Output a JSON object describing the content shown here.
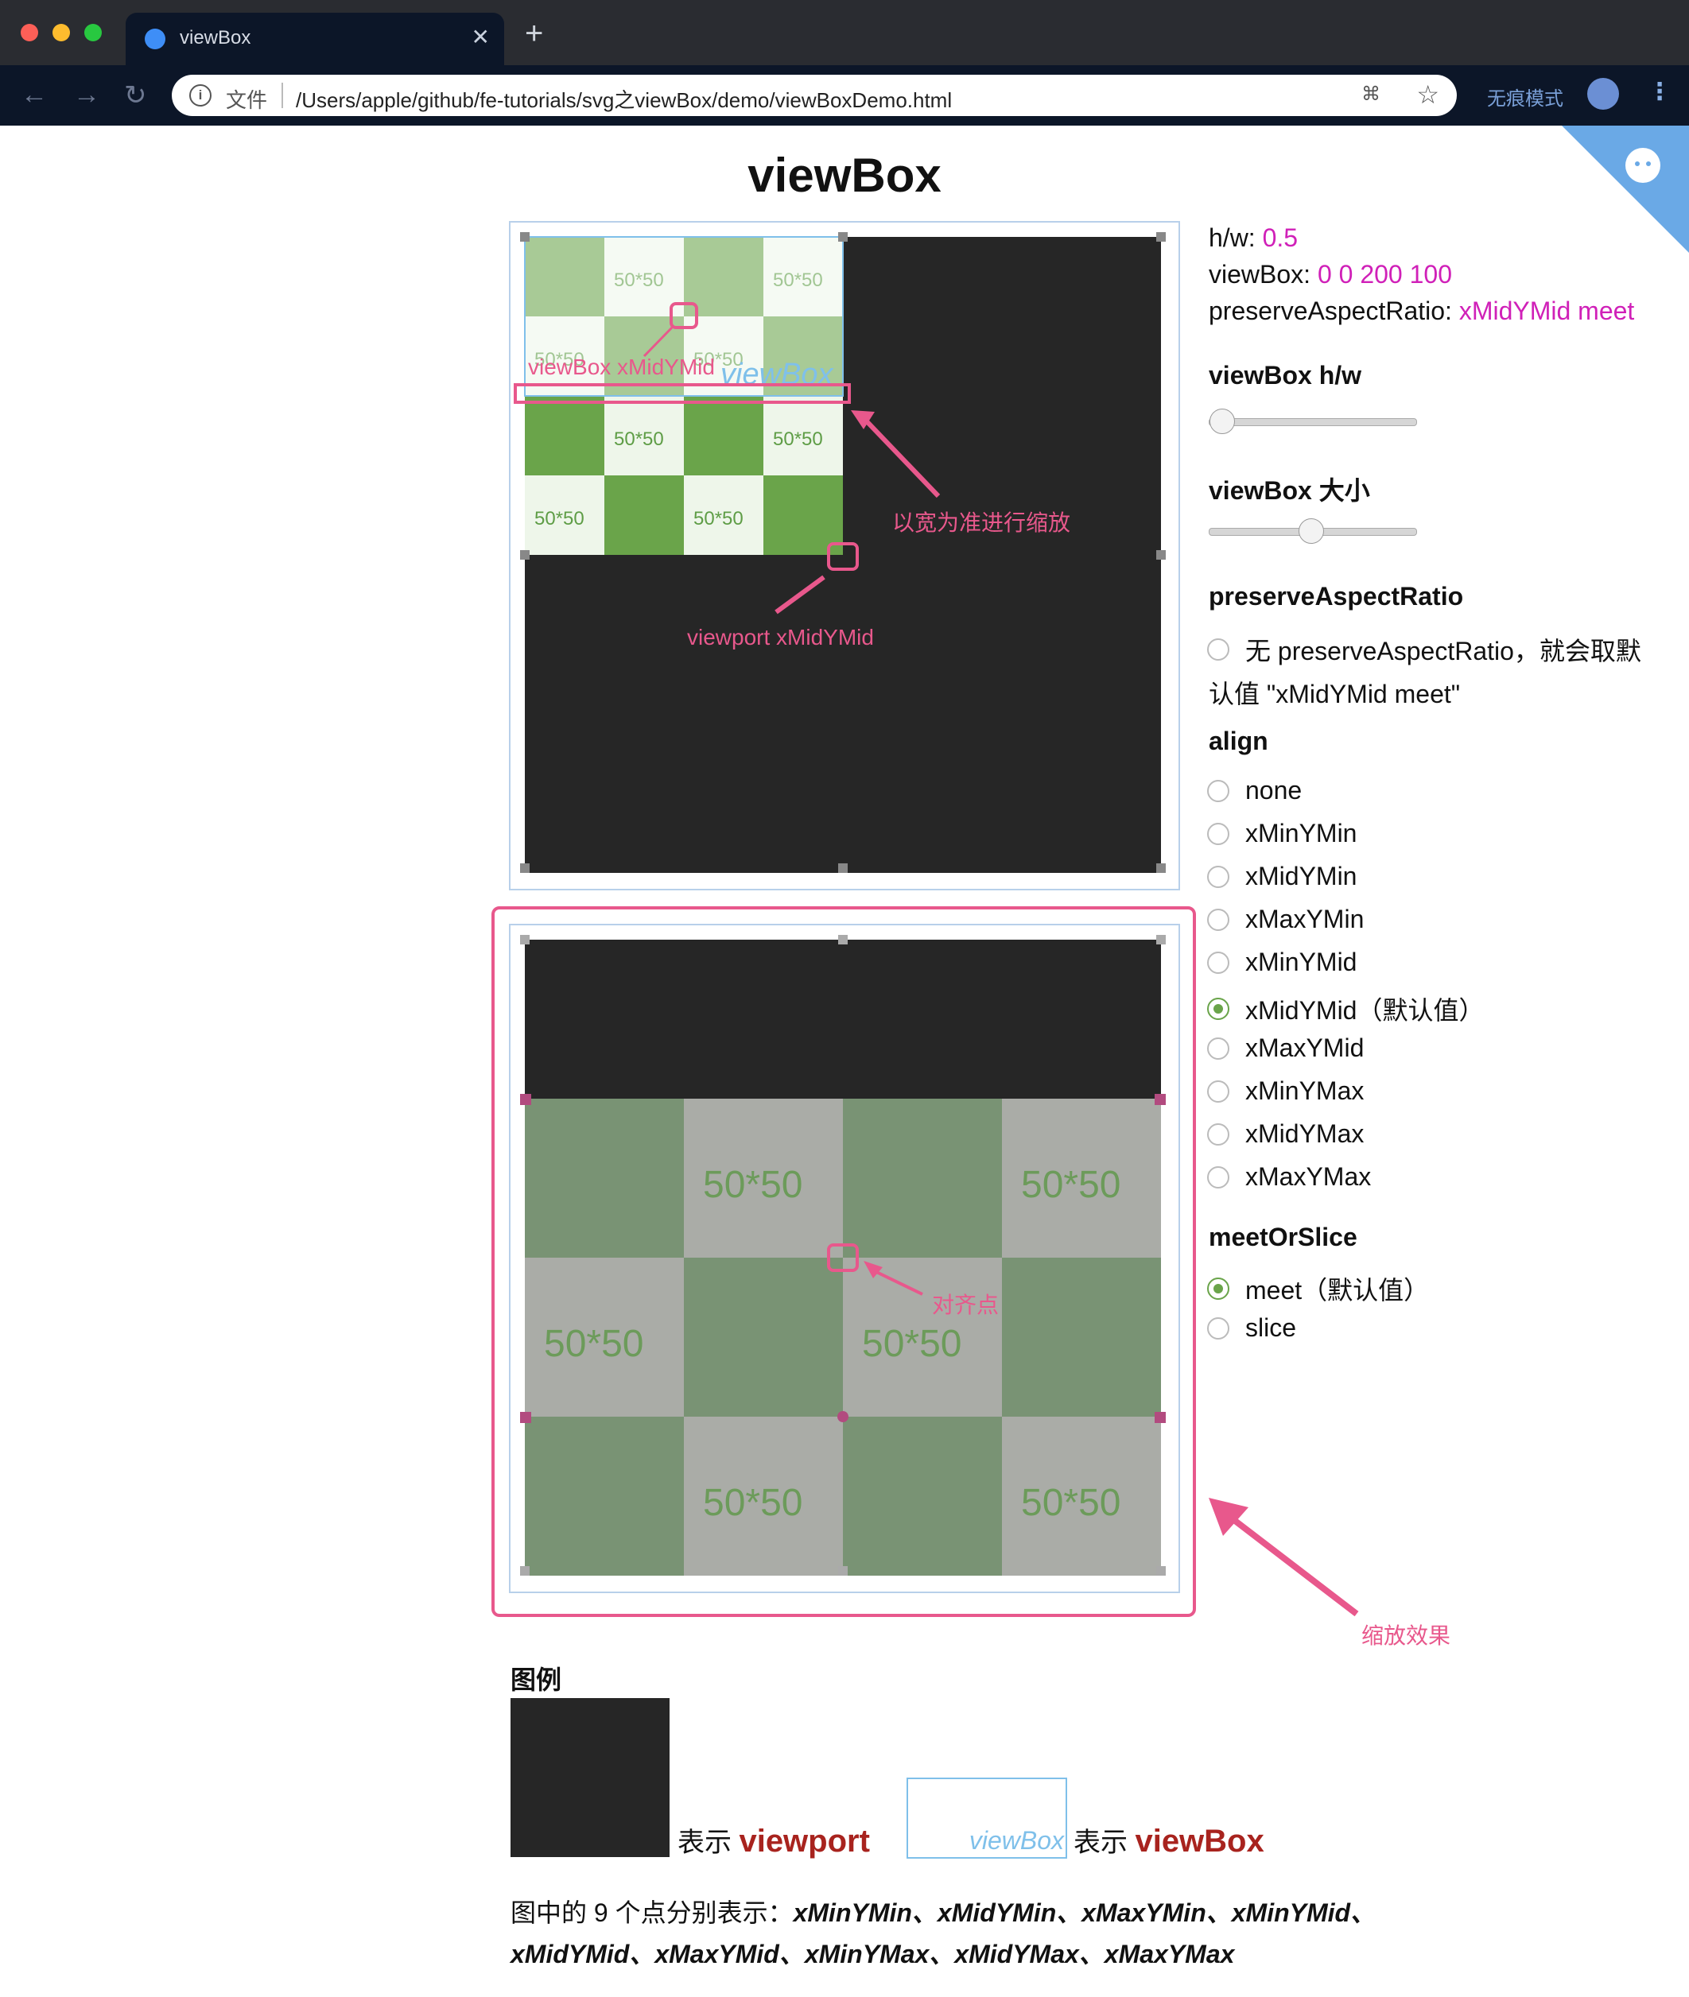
{
  "browser": {
    "tab_title": "viewBox",
    "address_file_label": "文件",
    "url": "/Users/apple/github/fe-tutorials/svg之viewBox/demo/viewBoxDemo.html",
    "incognito_label": "无痕模式"
  },
  "page": {
    "title": "viewBox",
    "info": {
      "hw_label": "h/w:",
      "hw_value": "0.5",
      "viewbox_label": "viewBox:",
      "viewbox_value": "0 0 200 100",
      "par_label": "preserveAspectRatio:",
      "par_value": "xMidYMid meet"
    },
    "controls": {
      "slider_hw_label": "viewBox h/w",
      "slider_hw_value": 0.0,
      "slider_size_label": "viewBox 大小",
      "slider_size_value": 0.5,
      "par_heading": "preserveAspectRatio",
      "no_par_option": "无 preserveAspectRatio，就会取默",
      "no_par_option_2": "认值 \"xMidYMid meet\"",
      "align_heading": "align",
      "align_options": [
        "none",
        "xMinYMin",
        "xMidYMin",
        "xMaxYMin",
        "xMinYMid",
        "xMidYMid（默认值）",
        "xMaxYMid",
        "xMinYMax",
        "xMidYMax",
        "xMaxYMax"
      ],
      "align_selected": "xMidYMid（默认值）",
      "meet_heading": "meetOrSlice",
      "meet_options": [
        "meet（默认值）",
        "slice"
      ],
      "meet_selected": "meet（默认值）"
    },
    "demo1": {
      "cell_label": "50*50",
      "viewbox_tag": "viewBox",
      "ann_viewbox": "viewBox xMidYMid",
      "ann_scale": "以宽为准进行缩放",
      "ann_viewport": "viewport xMidYMid"
    },
    "demo2": {
      "cell_label": "50*50",
      "ann_align": "对齐点",
      "ann_zoom": "缩放效果"
    },
    "legend": {
      "title": "图例",
      "vp_prefix": "表示",
      "vp_word": "viewport",
      "vb_tag": "viewBox",
      "vb_prefix": "表示",
      "vb_word": "viewBox",
      "desc_prefix": "图中的 9 个点分别表示：",
      "points": "xMinYMin、xMidYMin、xMaxYMin、xMinYMid、xMidYMid、xMaxYMid、xMinYMax、xMidYMax、xMaxYMax"
    },
    "colors": {
      "accent": "#d020b8",
      "annotation": "#e8588c",
      "viewport_bg": "#262626",
      "cell_dark": "#6aa44a",
      "cell_light": "#eef6ea"
    }
  }
}
